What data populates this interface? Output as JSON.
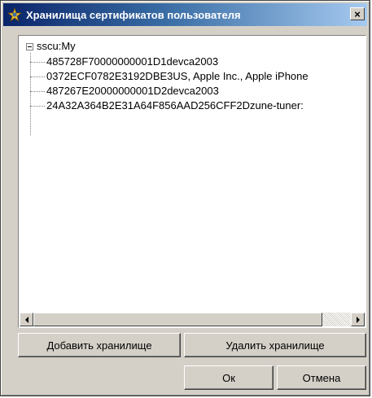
{
  "window": {
    "title": "Хранилища сертификатов пользователя",
    "close_glyph": "×"
  },
  "tree": {
    "root": {
      "label": "sscu:My",
      "expanded": true
    },
    "items": [
      {
        "label": "485728F70000000001D1devca2003"
      },
      {
        "label": "0372ECF0782E3192DBE3US, Apple Inc., Apple iPhone"
      },
      {
        "label": "487267E20000000001D2devca2003"
      },
      {
        "label": "24A32A364B2E31A64F856AAD256CFF2Dzune-tuner:"
      }
    ]
  },
  "scrollbar": {
    "left_arrow_icon": "arrow-left",
    "right_arrow_icon": "arrow-right"
  },
  "buttons": {
    "add_store": "Добавить хранилище",
    "delete_store": "Удалить хранилище",
    "ok": "Ок",
    "cancel": "Отмена"
  },
  "colors": {
    "title_gradient_start": "#0a246a",
    "title_gradient_end": "#a6caf0",
    "face": "#d4d0c8"
  }
}
